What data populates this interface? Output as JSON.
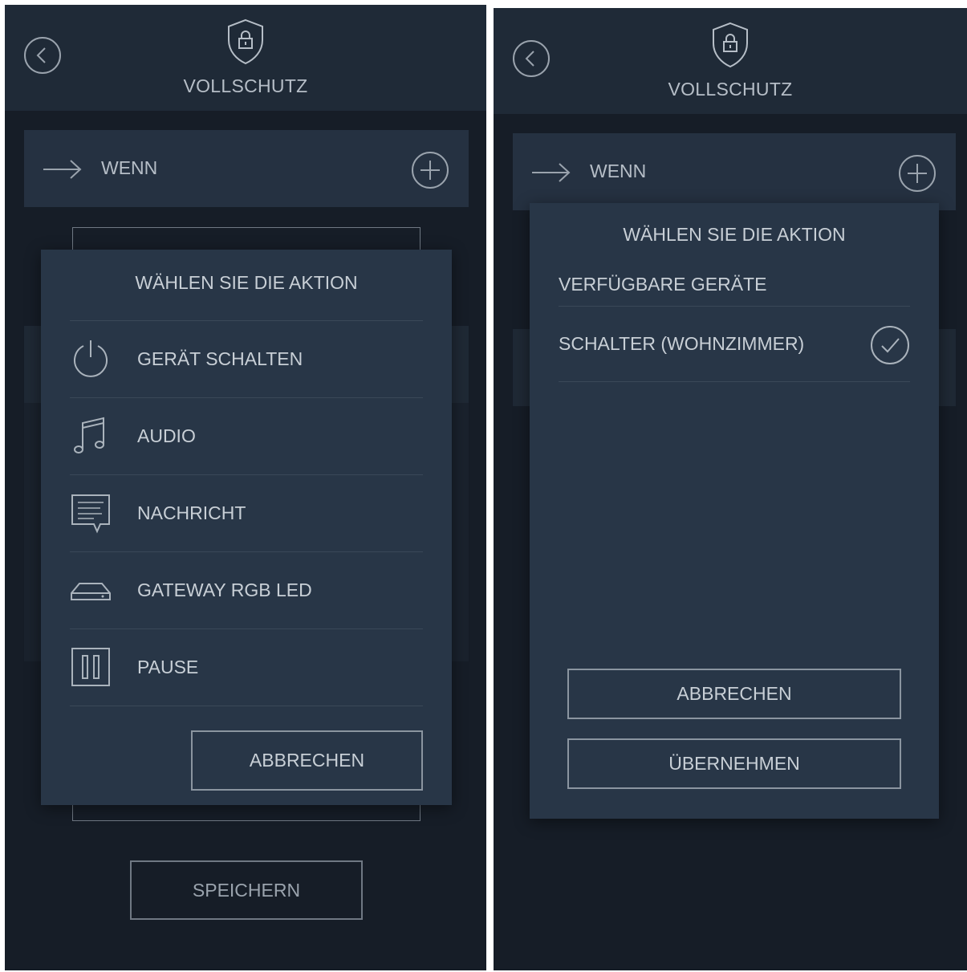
{
  "left": {
    "header": {
      "title": "VOLLSCHUTZ",
      "back_icon": "chevron-left-icon",
      "logo_icon": "shield-lock-icon"
    },
    "wenn": {
      "label": "WENN",
      "icon": "arrow-right-icon",
      "add_icon": "plus-circle-icon"
    },
    "dialog": {
      "title": "WÄHLEN SIE DIE AKTION",
      "items": [
        {
          "label": "GERÄT SCHALTEN",
          "icon": "power-icon"
        },
        {
          "label": "AUDIO",
          "icon": "music-note-icon"
        },
        {
          "label": "NACHRICHT",
          "icon": "message-icon"
        },
        {
          "label": "GATEWAY RGB LED",
          "icon": "gateway-device-icon"
        },
        {
          "label": "PAUSE",
          "icon": "pause-icon"
        }
      ],
      "cancel_label": "ABBRECHEN"
    },
    "save_label": "SPEICHERN"
  },
  "right": {
    "header": {
      "title": "VOLLSCHUTZ",
      "back_icon": "chevron-left-icon",
      "logo_icon": "shield-lock-icon"
    },
    "wenn": {
      "label": "WENN",
      "icon": "arrow-right-icon",
      "add_icon": "plus-circle-icon"
    },
    "dialog": {
      "title": "WÄHLEN SIE DIE AKTION",
      "section": "VERFÜGBARE GERÄTE",
      "device": {
        "label": "SCHALTER (WOHNZIMMER)",
        "selected": true
      },
      "cancel_label": "ABBRECHEN",
      "apply_label": "ÜBERNEHMEN"
    }
  },
  "colors": {
    "background": "#161d27",
    "header": "#1f2a37",
    "dialog": "#283647",
    "text": "#c8cfd6"
  }
}
